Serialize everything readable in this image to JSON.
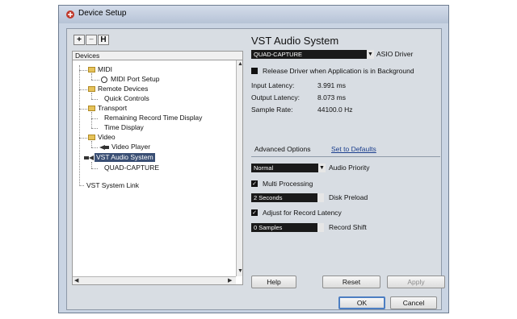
{
  "window": {
    "title": "Device Setup"
  },
  "toolbar": {
    "add": "+",
    "remove": "−",
    "reset": "H"
  },
  "devices": {
    "header": "Devices",
    "items": [
      {
        "label": "MIDI",
        "type": "folder"
      },
      {
        "label": "MIDI Port Setup",
        "type": "port"
      },
      {
        "label": "Remote Devices",
        "type": "folder"
      },
      {
        "label": "Quick Controls",
        "type": "leaf"
      },
      {
        "label": "Transport",
        "type": "folder"
      },
      {
        "label": "Remaining Record Time Display",
        "type": "leaf"
      },
      {
        "label": "Time Display",
        "type": "leaf"
      },
      {
        "label": "Video",
        "type": "folder"
      },
      {
        "label": "Video Player",
        "type": "video"
      },
      {
        "label": "VST Audio System",
        "type": "audio",
        "selected": true
      },
      {
        "label": "QUAD-CAPTURE",
        "type": "leaf"
      },
      {
        "label": "VST System Link",
        "type": "leaf"
      }
    ]
  },
  "panel": {
    "title": "VST Audio System",
    "asio_driver_value": "QUAD-CAPTURE",
    "asio_driver_label": "ASIO Driver",
    "release_driver_label": "Release Driver when Application is in Background",
    "input_latency_label": "Input Latency:",
    "input_latency_value": "3.991 ms",
    "output_latency_label": "Output Latency:",
    "output_latency_value": "8.073 ms",
    "sample_rate_label": "Sample Rate:",
    "sample_rate_value": "44100.0 Hz",
    "advanced_options": "Advanced Options",
    "set_to_defaults": "Set to Defaults",
    "audio_priority_value": "Normal",
    "audio_priority_label": "Audio Priority",
    "multi_processing_label": "Multi Processing",
    "disk_preload_value": "2 Seconds",
    "disk_preload_label": "Disk Preload",
    "adjust_record_latency_label": "Adjust for Record Latency",
    "record_shift_value": "0 Samples",
    "record_shift_label": "Record Shift"
  },
  "buttons": {
    "help": "Help",
    "reset": "Reset",
    "apply": "Apply",
    "ok": "OK",
    "cancel": "Cancel"
  },
  "icons": {
    "app": "cubase-logo-icon",
    "folder": "folder-icon",
    "port": "midi-port-icon",
    "video": "video-player-icon",
    "audio": "audio-device-icon"
  },
  "colors": {
    "selection": "#3a4f74",
    "folder": "#e6c35a",
    "window_frame": "#c9d4e3"
  }
}
